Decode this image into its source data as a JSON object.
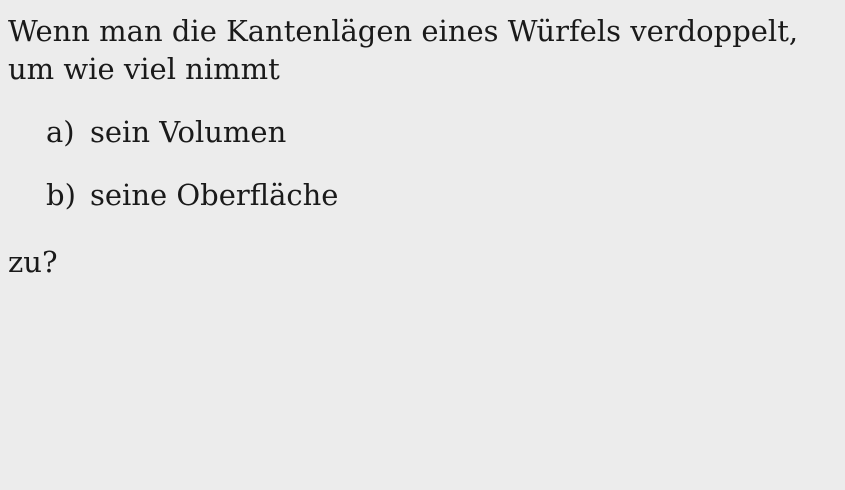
{
  "document": {
    "intro": "Wenn man die Kantenlägen eines Würfels verdoppelt, um wie viel nimmt",
    "items": [
      {
        "marker": "a)",
        "text": "sein Volumen"
      },
      {
        "marker": "b)",
        "text": "seine Oberfläche"
      }
    ],
    "closing": "zu?"
  }
}
